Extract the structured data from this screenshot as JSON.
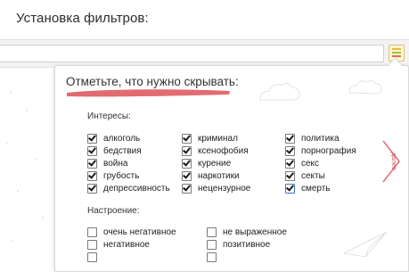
{
  "page": {
    "title": "Установка фильтров:"
  },
  "popup": {
    "title": "Отметьте, что нужно скрывать:",
    "interests": {
      "label": "Интересы:",
      "columns": [
        [
          {
            "label": "алкоголь",
            "checked": true
          },
          {
            "label": "бедствия",
            "checked": true
          },
          {
            "label": "война",
            "checked": true
          },
          {
            "label": "грубость",
            "checked": true
          },
          {
            "label": "депрессивность",
            "checked": true
          }
        ],
        [
          {
            "label": "криминал",
            "checked": true
          },
          {
            "label": "ксенофобия",
            "checked": true
          },
          {
            "label": "курение",
            "checked": true
          },
          {
            "label": "наркотики",
            "checked": true
          },
          {
            "label": "нецензурное",
            "checked": true
          }
        ],
        [
          {
            "label": "политика",
            "checked": true
          },
          {
            "label": "порнография",
            "checked": true
          },
          {
            "label": "секс",
            "checked": true
          },
          {
            "label": "секты",
            "checked": true
          },
          {
            "label": "смерть",
            "checked": true
          }
        ]
      ]
    },
    "mood": {
      "label": "Настроение:",
      "columns": [
        [
          {
            "label": "очень негативное",
            "checked": false
          },
          {
            "label": "негативное",
            "checked": false
          }
        ],
        [
          {
            "label": "не выраженное",
            "checked": false
          },
          {
            "label": "позитивное",
            "checked": false
          }
        ]
      ]
    },
    "next_label": "далее"
  },
  "colors": {
    "accent": "#e8707a",
    "brush": "#e26b72",
    "checkbox_border": "#7a7a7a"
  },
  "icons": {
    "extension": "filter-list-icon",
    "next": "chevron-right-icon"
  }
}
